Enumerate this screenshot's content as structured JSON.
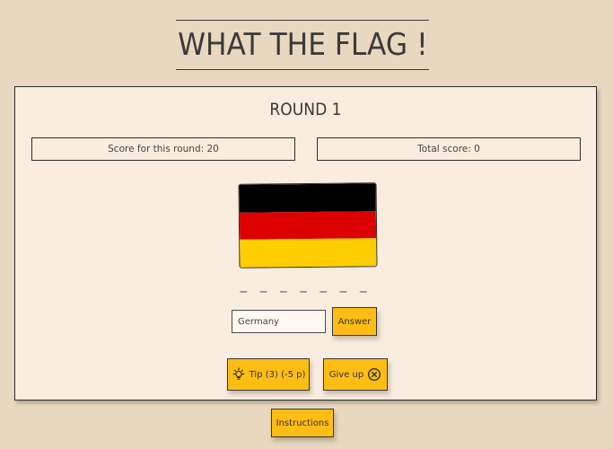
{
  "header": {
    "title": "WHAT THE FLAG !"
  },
  "game": {
    "round_label": "ROUND 1",
    "round_score_label": "Score for this round: 20",
    "total_score_label": "Total score: 0",
    "flag": {
      "name": "germany-flag",
      "colors": [
        "#000000",
        "#dd0000",
        "#ffce00"
      ]
    },
    "answer_mask": "_ _ _ _ _ _ _",
    "answer_input": {
      "value": "Germany",
      "placeholder": ""
    },
    "buttons": {
      "answer": "Answer",
      "tip": "Tip (3) (-5 p)",
      "give_up": "Give up"
    },
    "icons": {
      "tip": "lightbulb-icon",
      "give_up": "close-circle-icon"
    }
  },
  "footer": {
    "instructions": "Instructions"
  },
  "colors": {
    "background": "#e8d8bf",
    "card": "#f9ede0",
    "button": "#fdbd14"
  }
}
